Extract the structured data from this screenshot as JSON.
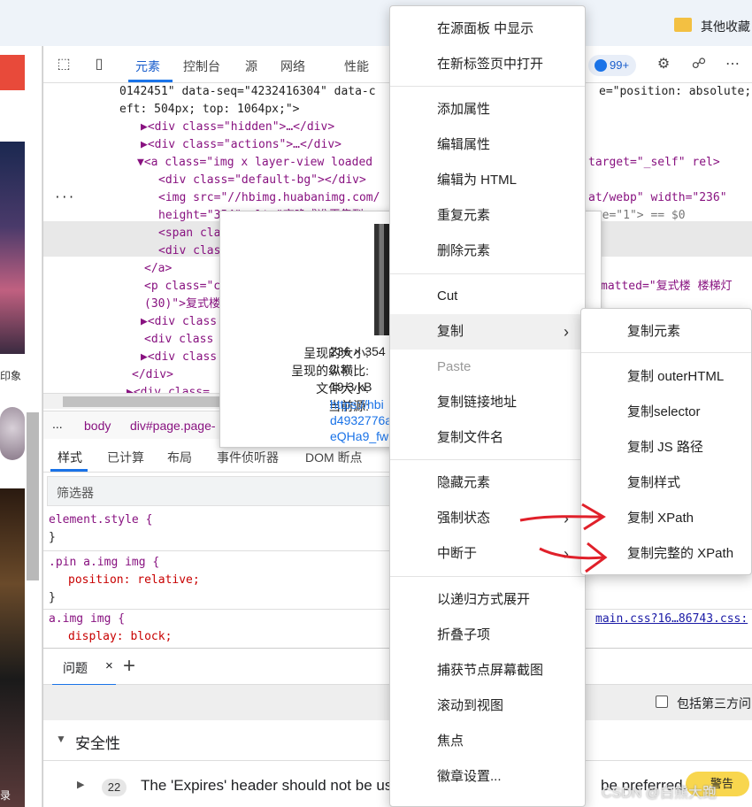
{
  "browser": {
    "bookmarks_folder": "其他收藏"
  },
  "devtools": {
    "tabs": [
      "元素",
      "控制台",
      "源",
      "网络",
      "性能"
    ],
    "issues_badge": "99+",
    "dom_lines": [
      {
        "text": "0142451\" data-seq=\"4232416304\" data-c",
        "tail": "e=\"position: absolute;"
      },
      {
        "text": "eft: 504px; top: 1064px;\">"
      },
      {
        "text": "▶<div class=\"hidden\">…</div>"
      },
      {
        "text": "▶<div class=\"actions\">…</div>"
      },
      {
        "text": "▼<a class=\"img x layer-view loaded",
        "tail": "target=\"_self\" rel>"
      },
      {
        "text": "<div class=\"default-bg\"></div>"
      },
      {
        "text": "<img src=\"//hbimg.huabanimg.com/",
        "tail": "at/webp\" width=\"236\""
      },
      {
        "text": "height=\"354\" alt=\"夜晚式准平集到",
        "tail": "ore=\"1\"> == $0"
      },
      {
        "text": "<span cla"
      },
      {
        "text": "<div clas"
      },
      {
        "text": "</a>"
      },
      {
        "text": "<p class=\"c",
        "tail": "matted=\"复式楼  楼梯灯"
      },
      {
        "text": "(30)\">复式楼"
      },
      {
        "text": "▶<div class"
      },
      {
        "text": "<div class"
      },
      {
        "text": "▶<div class"
      },
      {
        "text": "</div>"
      },
      {
        "text": "▶<div class="
      }
    ],
    "breadcrumbs": [
      "...",
      "body",
      "div#page.page-"
    ],
    "styles_tabs": [
      "样式",
      "已计算",
      "布局",
      "事件侦听器",
      "DOM 断点"
    ],
    "filter_placeholder": "筛选器",
    "css_rules": [
      {
        "selector": "element.style {",
        "decl": "",
        "close": "}"
      },
      {
        "selector": ".pin a.img img {",
        "decl": "position: relative;",
        "close": "}"
      },
      {
        "selector": "a.img img {",
        "decl": "display: block;",
        "source": "main.css?16…86743.css:"
      }
    ],
    "drawer": {
      "tab": "问题",
      "close": "×",
      "add": "+",
      "third_party": "包括第三方问",
      "section": "安全性",
      "issue_count": "22",
      "issue_text": "The 'Expires' header should not be us",
      "issue_tail": "be preferred.",
      "warning_label": "警告"
    }
  },
  "tooltip": {
    "rows": [
      {
        "key": "呈现的大小:",
        "value": "236 × 354"
      },
      {
        "key": "呈现的纵横比:",
        "value": "2:3"
      },
      {
        "key": "文件大小:",
        "value": "19.3 kB"
      },
      {
        "key": "当前源:",
        "value": "https://hbi"
      }
    ],
    "source_cont": [
      "d4932776a",
      "eQHa9_fw"
    ]
  },
  "context_menu": {
    "items": [
      {
        "label": "在源面板 中显示"
      },
      {
        "label": "在新标签页中打开"
      },
      {
        "label": "添加属性"
      },
      {
        "label": "编辑属性"
      },
      {
        "label": "编辑为 HTML"
      },
      {
        "label": "重复元素"
      },
      {
        "label": "删除元素"
      },
      {
        "label": "Cut"
      },
      {
        "label": "复制"
      },
      {
        "label": "Paste"
      },
      {
        "label": "复制链接地址"
      },
      {
        "label": "复制文件名"
      },
      {
        "label": "隐藏元素"
      },
      {
        "label": "强制状态"
      },
      {
        "label": "中断于"
      },
      {
        "label": "以递归方式展开"
      },
      {
        "label": "折叠子项"
      },
      {
        "label": "捕获节点屏幕截图"
      },
      {
        "label": "滚动到视图"
      },
      {
        "label": "焦点"
      },
      {
        "label": "徽章设置..."
      }
    ]
  },
  "copy_submenu": {
    "items": [
      "复制元素",
      "复制 outerHTML",
      "复制selector",
      "复制 JS 路径",
      "复制样式",
      "复制 XPath",
      "复制完整的 XPath"
    ]
  },
  "page_strip": {
    "sidebar_text_1": "印象",
    "sidebar_text_2": "录"
  },
  "watermark": "CSDN @白熊大跑",
  "colors": {
    "annotation_arrow": "#e0202a",
    "accent": "#1a73e8"
  }
}
